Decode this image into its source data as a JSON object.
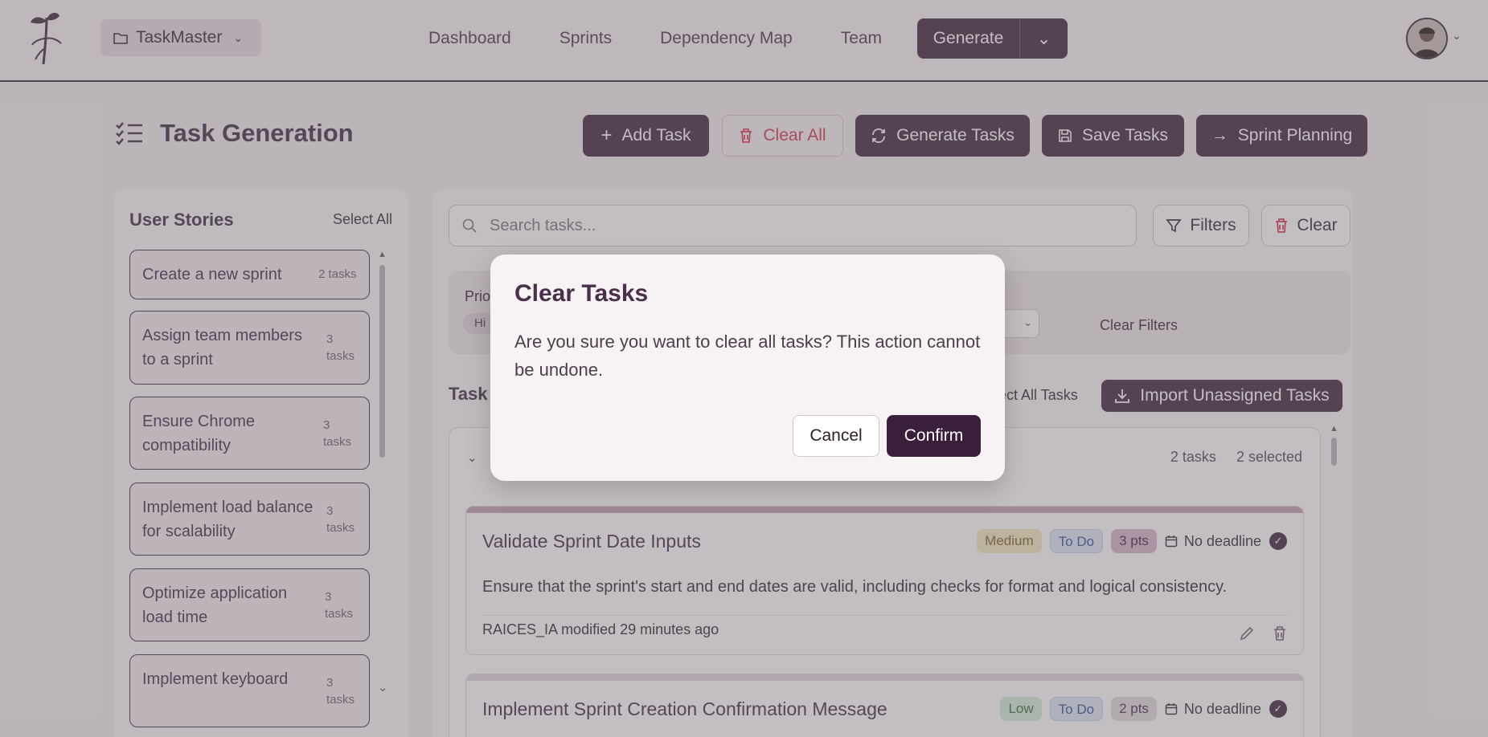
{
  "header": {
    "project": "TaskMaster",
    "nav": [
      "Dashboard",
      "Sprints",
      "Dependency Map",
      "Team"
    ],
    "generate_label": "Generate"
  },
  "page": {
    "title": "Task Generation",
    "buttons": {
      "add_task": "Add Task",
      "clear_all": "Clear All",
      "generate_tasks": "Generate Tasks",
      "save_tasks": "Save Tasks",
      "sprint_planning": "Sprint Planning"
    }
  },
  "sidebar": {
    "title": "User Stories",
    "select_all": "Select All",
    "stories": [
      {
        "label": "Create a new sprint",
        "count": "2 tasks"
      },
      {
        "label": "Assign team members to a sprint",
        "count": "3 tasks"
      },
      {
        "label": "Ensure Chrome compatibility",
        "count": "3 tasks"
      },
      {
        "label": "Implement load balance for scalability",
        "count": "3 tasks"
      },
      {
        "label": "Optimize application load time",
        "count": "3 tasks"
      },
      {
        "label": "Implement keyboard",
        "count": "3 tasks"
      }
    ]
  },
  "main": {
    "search_placeholder": "Search tasks...",
    "filters_label": "Filters",
    "clear_label": "Clear",
    "priority_label": "Prio",
    "priority_chip": "Hi",
    "clear_filters": "Clear Filters",
    "tasks_heading": "Task",
    "select_all_tasks": "lect All Tasks",
    "import_label": "Import Unassigned Tasks",
    "group": {
      "tasks_count": "2 tasks",
      "selected_count": "2 selected"
    },
    "cards": [
      {
        "title": "Validate Sprint Date Inputs",
        "priority": "Medium",
        "status": "To Do",
        "points": "3 pts",
        "deadline": "No deadline",
        "description": "Ensure that the sprint's start and end dates are valid, including checks for format and logical consistency.",
        "author": "RAICES_IA",
        "modified": "modified 29 minutes ago"
      },
      {
        "title": "Implement Sprint Creation Confirmation Message",
        "priority": "Low",
        "status": "To Do",
        "points": "2 pts",
        "deadline": "No deadline"
      }
    ]
  },
  "modal": {
    "title": "Clear Tasks",
    "body": "Are you sure you want to clear all tasks? This action cannot be undone.",
    "cancel": "Cancel",
    "confirm": "Confirm"
  },
  "colors": {
    "brand": "#3a1f3a",
    "danger": "#d22f40",
    "medium_badge": "#f5ecc0",
    "low_badge": "#d4efd9",
    "todo_badge": "#dce7f8"
  }
}
